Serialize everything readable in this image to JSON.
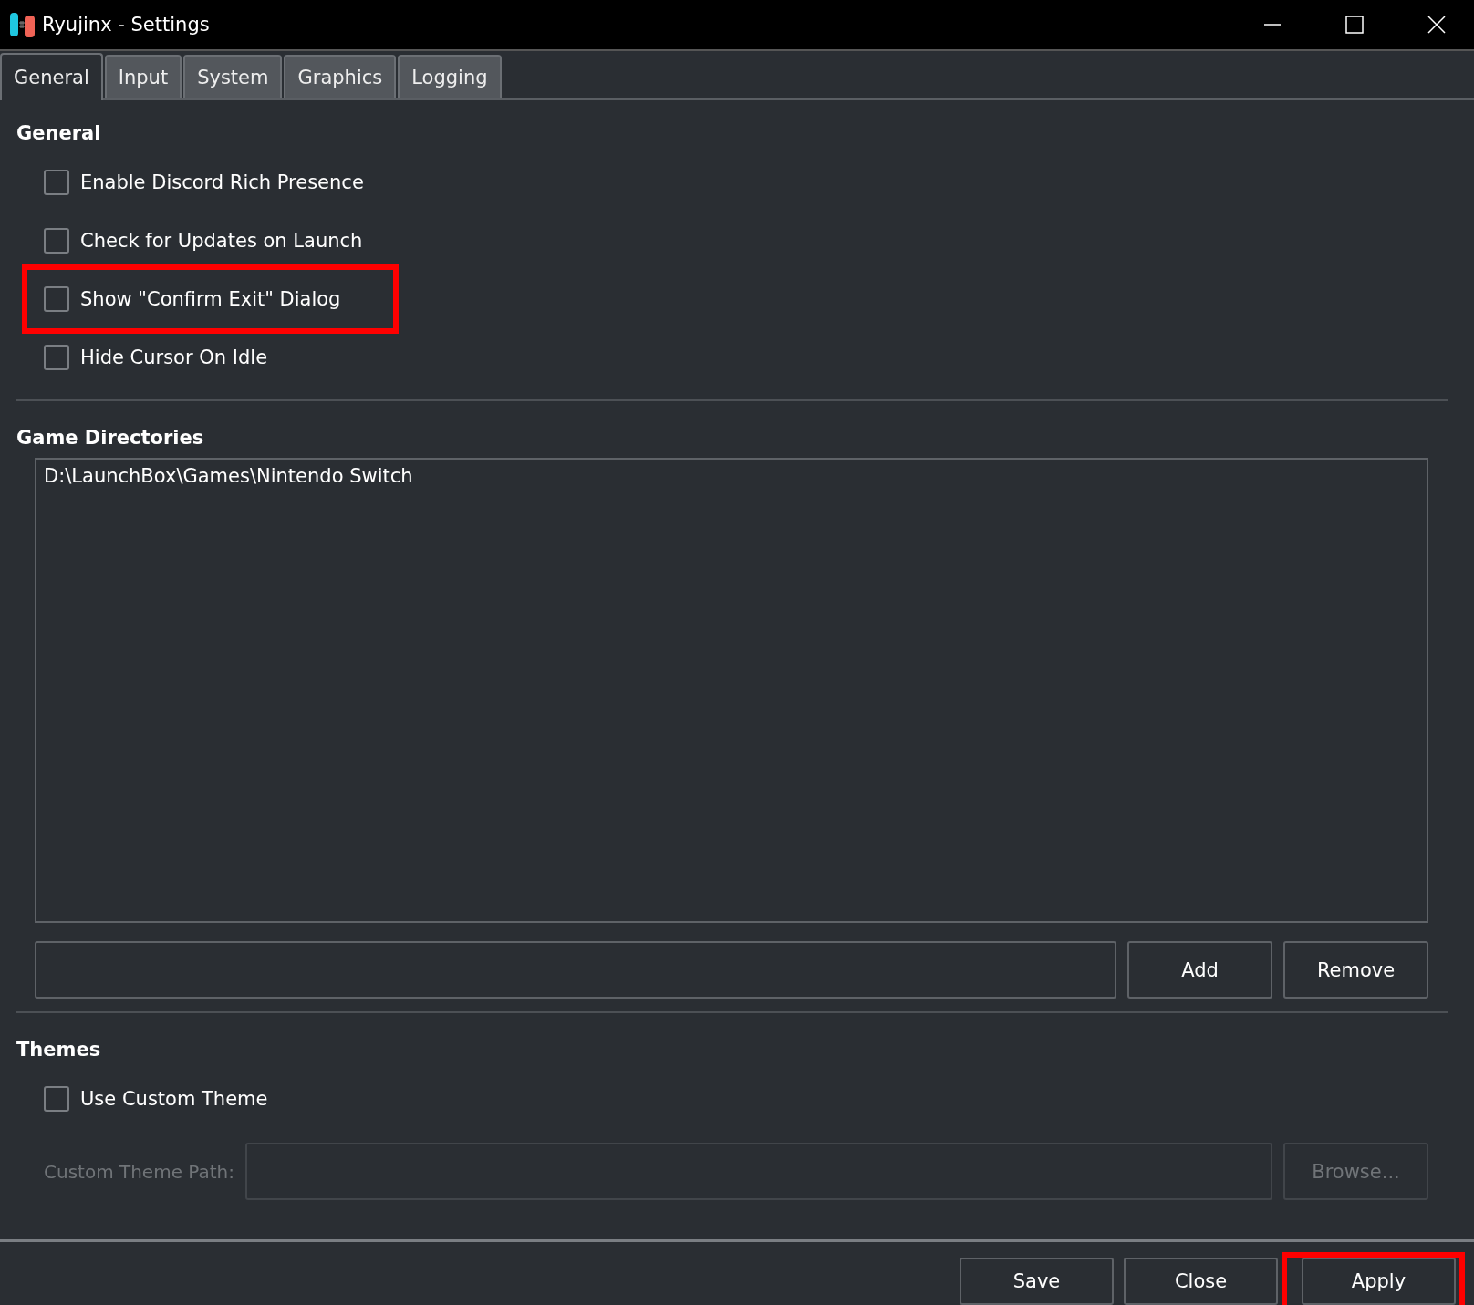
{
  "window": {
    "title": "Ryujinx - Settings"
  },
  "tabs": [
    {
      "label": "General",
      "selected": true
    },
    {
      "label": "Input",
      "selected": false
    },
    {
      "label": "System",
      "selected": false
    },
    {
      "label": "Graphics",
      "selected": false
    },
    {
      "label": "Logging",
      "selected": false
    }
  ],
  "general": {
    "heading": "General",
    "options": [
      {
        "label": "Enable Discord Rich Presence",
        "checked": false,
        "highlighted": false
      },
      {
        "label": "Check for Updates on Launch",
        "checked": false,
        "highlighted": false
      },
      {
        "label": "Show \"Confirm Exit\" Dialog",
        "checked": false,
        "highlighted": true
      },
      {
        "label": "Hide Cursor On Idle",
        "checked": false,
        "highlighted": false
      }
    ]
  },
  "game_directories": {
    "heading": "Game Directories",
    "items": [
      "D:\\LaunchBox\\Games\\Nintendo Switch"
    ],
    "buttons": [
      "Add",
      "Remove"
    ]
  },
  "themes": {
    "heading": "Themes",
    "option": {
      "label": "Use Custom Theme",
      "checked": false
    },
    "path_label": "Custom Theme Path:",
    "browse": "Browse...",
    "disabled": true
  },
  "footer_buttons": [
    {
      "label": "Save",
      "highlighted": false
    },
    {
      "label": "Close",
      "highlighted": false
    },
    {
      "label": "Apply",
      "highlighted": true
    }
  ]
}
